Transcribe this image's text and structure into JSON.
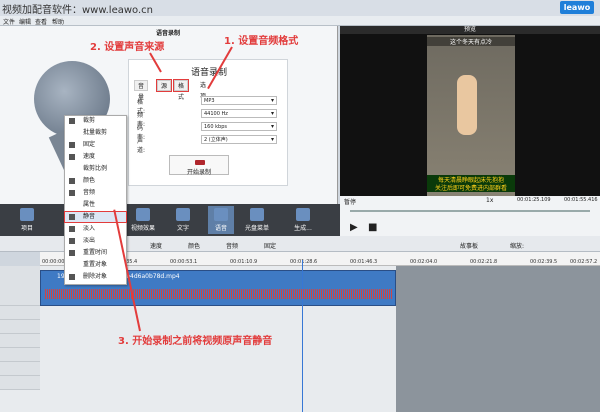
{
  "window": {
    "title": "视频加配音软件：www.leawo.cn",
    "logo": "leawo"
  },
  "menu": [
    "文件",
    "编辑",
    "查看",
    "帮助"
  ],
  "left_panel": {
    "header": "语音录制"
  },
  "record_box": {
    "title": "语音录制",
    "tabs": [
      "音量",
      "源",
      "格式",
      "选项"
    ],
    "fields": [
      {
        "label": "格式:",
        "value": "MP3"
      },
      {
        "label": "频率:",
        "value": "44100 Hz"
      },
      {
        "label": "码率:",
        "value": "160 kbps"
      },
      {
        "label": "声道:",
        "value": "2 (立体声)"
      }
    ],
    "start_button": "开始录制"
  },
  "context_menu": [
    "裁剪",
    "批量裁剪",
    "固定",
    "速度",
    "裁剪比例",
    "颜色",
    "音频",
    "属性",
    "静音",
    "淡入",
    "淡出",
    "重置时间",
    "重置对象",
    "删除对象"
  ],
  "annotations": {
    "a1": "1. 设置音频格式",
    "a2": "2. 设置声音来源",
    "a3": "3. 开始录制之前将视频原声音静音"
  },
  "preview": {
    "header": "预览",
    "caption_top": "这个冬天有点冷",
    "caption_bottom": "每天清晨睁眼起床先抱抱",
    "caption_bottom2": "关注后即可免费进内部群看",
    "status": "暂停",
    "speed": "1x",
    "time_current": "00:01:25.109",
    "time_total": "00:01:55.416"
  },
  "toolbar": [
    "项目",
    "",
    "视频效果",
    "文字",
    "语音",
    "光盘菜单",
    "生成..."
  ],
  "edit_bar": [
    "速度",
    "颜色",
    "音频",
    "固定",
    "故事板",
    "缩放:"
  ],
  "ruler": [
    "00:00:00.0",
    "00:00:35.4",
    "00:00:53.1",
    "00:01:10.9",
    "00:01:28.6",
    "00:01:46.3",
    "00:02:04.0",
    "00:02:21.8",
    "00:02:39.5",
    "00:02:57.2"
  ],
  "clip": {
    "name": "1900bccc3aaccaba7e9b4d6a0b78d.mp4"
  }
}
